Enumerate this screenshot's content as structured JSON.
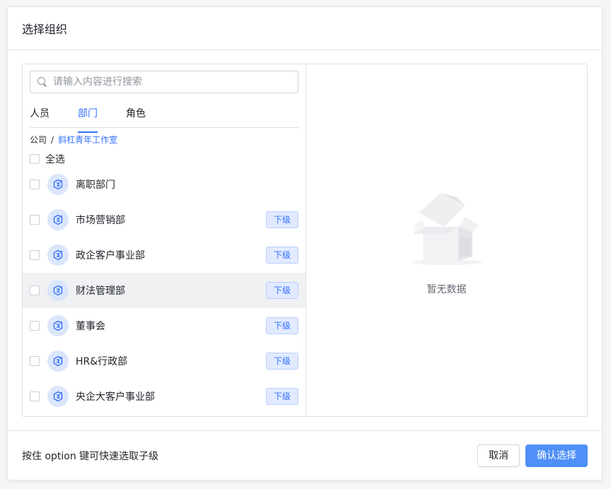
{
  "dialog": {
    "title": "选择组织"
  },
  "search": {
    "placeholder": "请输入内容进行搜索"
  },
  "tabs": [
    {
      "label": "人员",
      "active": false
    },
    {
      "label": "部门",
      "active": true
    },
    {
      "label": "角色",
      "active": false
    }
  ],
  "breadcrumb": {
    "root": "公司",
    "separator": "/",
    "current": "斜杠青年工作室"
  },
  "select_all": {
    "label": "全选"
  },
  "departments": [
    {
      "name": "离职部门",
      "sub_label": ""
    },
    {
      "name": "市场营销部",
      "sub_label": "下级"
    },
    {
      "name": "政企客户事业部",
      "sub_label": "下级"
    },
    {
      "name": "财法管理部",
      "sub_label": "下级"
    },
    {
      "name": "董事会",
      "sub_label": "下级"
    },
    {
      "name": "HR&行政部",
      "sub_label": "下级"
    },
    {
      "name": "央企大客户事业部",
      "sub_label": "下级"
    }
  ],
  "empty_state": {
    "text": "暂无数据",
    "icon": "empty-box-icon"
  },
  "footer": {
    "hint": "按住 option 键可快速选取子级",
    "cancel_label": "取消",
    "confirm_label": "确认选择"
  },
  "colors": {
    "accent": "#3370ff",
    "confirm_button": "#4e8ff8",
    "tag_background": "#e1eaff",
    "icon_circle": "#dbe6fb"
  }
}
